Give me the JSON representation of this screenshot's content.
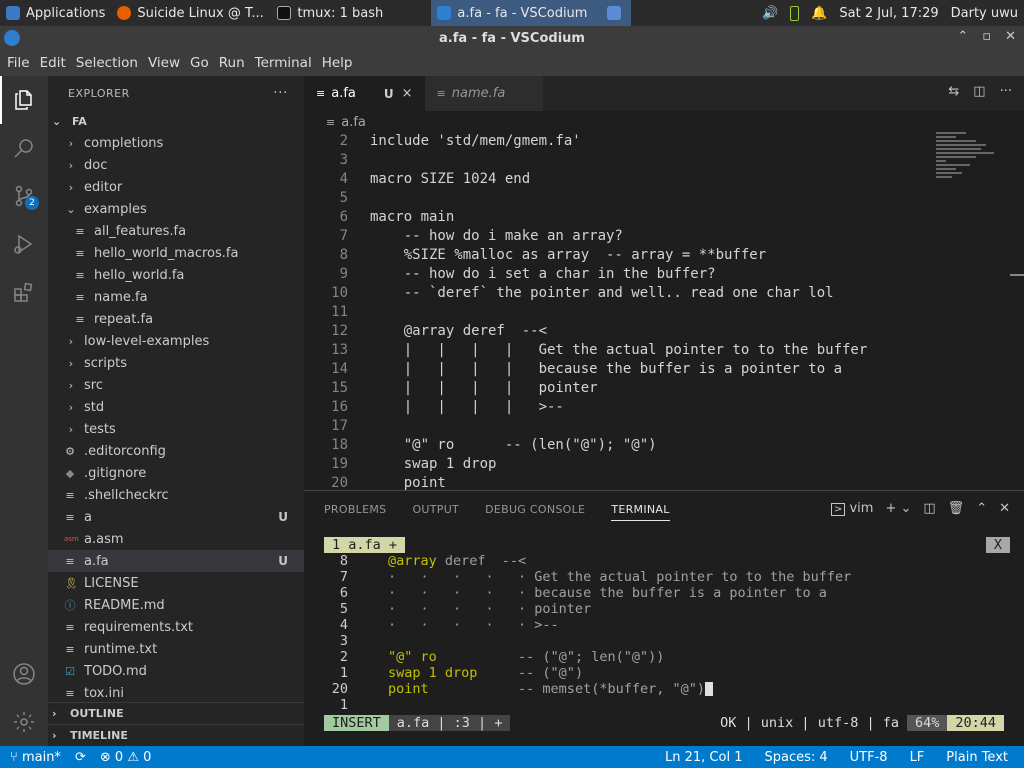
{
  "taskbar": {
    "items": [
      "Applications",
      "Suicide Linux @ T...",
      "tmux: 1 bash",
      "a.fa - fa - VSCodium"
    ],
    "clock": "Sat  2 Jul, 17:29",
    "user": "Darty uwu"
  },
  "window": {
    "title": "a.fa - fa - VSCodium"
  },
  "menu": [
    "File",
    "Edit",
    "Selection",
    "View",
    "Go",
    "Run",
    "Terminal",
    "Help"
  ],
  "activity": {
    "scm_badge": "2"
  },
  "explorer": {
    "title": "EXPLORER",
    "root": "FA",
    "items": [
      {
        "label": "completions",
        "type": "folder",
        "open": false,
        "indent": 1
      },
      {
        "label": "doc",
        "type": "folder",
        "open": false,
        "indent": 1
      },
      {
        "label": "editor",
        "type": "folder",
        "open": false,
        "indent": 1
      },
      {
        "label": "examples",
        "type": "folder",
        "open": true,
        "indent": 1
      },
      {
        "label": "all_features.fa",
        "type": "file",
        "indent": 2
      },
      {
        "label": "hello_world_macros.fa",
        "type": "file",
        "indent": 2
      },
      {
        "label": "hello_world.fa",
        "type": "file",
        "indent": 2
      },
      {
        "label": "name.fa",
        "type": "file",
        "indent": 2
      },
      {
        "label": "repeat.fa",
        "type": "file",
        "indent": 2
      },
      {
        "label": "low-level-examples",
        "type": "folder",
        "open": false,
        "indent": 1
      },
      {
        "label": "scripts",
        "type": "folder",
        "open": false,
        "indent": 1
      },
      {
        "label": "src",
        "type": "folder",
        "open": false,
        "indent": 1
      },
      {
        "label": "std",
        "type": "folder",
        "open": false,
        "indent": 1
      },
      {
        "label": "tests",
        "type": "folder",
        "open": false,
        "indent": 1
      },
      {
        "label": ".editorconfig",
        "type": "file",
        "icon": "gear",
        "indent": 1
      },
      {
        "label": ".gitignore",
        "type": "file",
        "icon": "git",
        "indent": 1
      },
      {
        "label": ".shellcheckrc",
        "type": "file",
        "indent": 1
      },
      {
        "label": "a",
        "type": "file",
        "indent": 1,
        "status": "U"
      },
      {
        "label": "a.asm",
        "type": "file",
        "icon": "asm",
        "indent": 1
      },
      {
        "label": "a.fa",
        "type": "file",
        "indent": 1,
        "status": "U",
        "selected": true
      },
      {
        "label": "LICENSE",
        "type": "file",
        "icon": "license",
        "indent": 1
      },
      {
        "label": "README.md",
        "type": "file",
        "icon": "info",
        "indent": 1
      },
      {
        "label": "requirements.txt",
        "type": "file",
        "indent": 1
      },
      {
        "label": "runtime.txt",
        "type": "file",
        "indent": 1
      },
      {
        "label": "TODO.md",
        "type": "file",
        "icon": "check",
        "indent": 1
      },
      {
        "label": "tox.ini",
        "type": "file",
        "indent": 1
      }
    ],
    "outline": "OUTLINE",
    "timeline": "TIMELINE"
  },
  "tabs": [
    {
      "label": "a.fa",
      "status": "U",
      "close": "×",
      "active": true
    },
    {
      "label": "name.fa",
      "active": false,
      "preview": true
    }
  ],
  "breadcrumb": "a.fa",
  "code": [
    {
      "n": "2",
      "t": "include 'std/mem/gmem.fa'"
    },
    {
      "n": "3",
      "t": ""
    },
    {
      "n": "4",
      "t": "macro SIZE 1024 end"
    },
    {
      "n": "5",
      "t": ""
    },
    {
      "n": "6",
      "t": "macro main"
    },
    {
      "n": "7",
      "t": "    -- how do i make an array?"
    },
    {
      "n": "8",
      "t": "    %SIZE %malloc as array  -- array = **buffer"
    },
    {
      "n": "9",
      "t": "    -- how do i set a char in the buffer?"
    },
    {
      "n": "10",
      "t": "    -- `deref` the pointer and well.. read one char lol"
    },
    {
      "n": "11",
      "t": ""
    },
    {
      "n": "12",
      "t": "    @array deref  --<"
    },
    {
      "n": "13",
      "t": "    |   |   |   |   Get the actual pointer to to the buffer"
    },
    {
      "n": "14",
      "t": "    |   |   |   |   because the buffer is a pointer to a"
    },
    {
      "n": "15",
      "t": "    |   |   |   |   pointer"
    },
    {
      "n": "16",
      "t": "    |   |   |   |   >--"
    },
    {
      "n": "17",
      "t": ""
    },
    {
      "n": "18",
      "t": "    \"@\" ro      -- (len(\"@\"); \"@\")"
    },
    {
      "n": "19",
      "t": "    swap 1 drop"
    },
    {
      "n": "20",
      "t": "    point"
    }
  ],
  "panel": {
    "tabs": [
      "PROBLEMS",
      "OUTPUT",
      "DEBUG CONSOLE",
      "TERMINAL"
    ],
    "active_tab": "TERMINAL",
    "terminal_name": "vim"
  },
  "terminal": {
    "vim_tab": "1 a.fa +",
    "close": "X",
    "lines": [
      {
        "n": "8",
        "kw": "@array",
        "rest": " deref  --<"
      },
      {
        "n": "7",
        "kw": "",
        "rest": "·   ·   ·   ·   · Get the actual pointer to to the buffer"
      },
      {
        "n": "6",
        "kw": "",
        "rest": "·   ·   ·   ·   · because the buffer is a pointer to a"
      },
      {
        "n": "5",
        "kw": "",
        "rest": "·   ·   ·   ·   · pointer"
      },
      {
        "n": "4",
        "kw": "",
        "rest": "·   ·   ·   ·   · >--"
      },
      {
        "n": "3",
        "kw": "",
        "rest": ""
      },
      {
        "n": "2",
        "kw": "\"@\" ro",
        "rest": "          -- (\"@\"; len(\"@\"))"
      },
      {
        "n": "1",
        "kw": "swap 1 drop",
        "rest": "     -- (\"@\")"
      },
      {
        "n": "20",
        "kw": "point",
        "rest": "           -- memset(*buffer, \"@\")"
      },
      {
        "n": "1",
        "kw": "",
        "rest": ""
      }
    ],
    "status": {
      "mode": "INSERT",
      "file": "a.fa | :3 | +",
      "info": "OK | unix | utf-8 | fa",
      "percent": "64%",
      "pos": "20:44"
    }
  },
  "statusbar": {
    "branch": "main*",
    "errors": "0",
    "warnings": "0",
    "position": "Ln 21, Col 1",
    "spaces": "Spaces: 4",
    "encoding": "UTF-8",
    "eol": "LF",
    "language": "Plain Text"
  }
}
